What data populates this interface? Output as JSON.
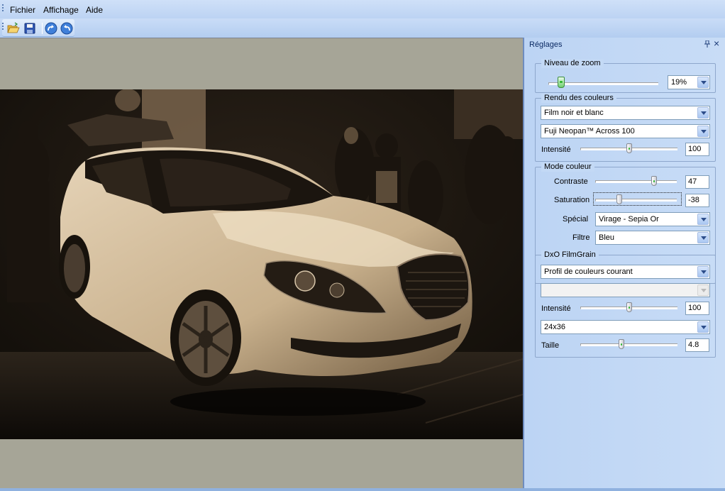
{
  "menu": {
    "items": [
      {
        "label": "Fichier"
      },
      {
        "label": "Affichage"
      },
      {
        "label": "Aide"
      }
    ]
  },
  "toolbar": {
    "icons": [
      "open-folder-icon",
      "save-icon",
      "redo-icon",
      "undo-icon"
    ]
  },
  "panel": {
    "title": "Réglages",
    "zoom": {
      "legend": "Niveau de zoom",
      "value": "19%",
      "slider_fraction": 0.12
    },
    "color_rendering": {
      "legend": "Rendu des couleurs",
      "category": "Film noir et blanc",
      "film": "Fuji Neopan™ Across 100",
      "intensity_label": "Intensité",
      "intensity_value": "100"
    },
    "color_mode": {
      "legend": "Mode couleur",
      "contrast_label": "Contraste",
      "contrast_value": "47",
      "saturation_label": "Saturation",
      "saturation_value": "-38",
      "special_label": "Spécial",
      "special_value": "Virage - Sepia Or",
      "filter_label": "Filtre",
      "filter_value": "Bleu"
    },
    "filmgrain": {
      "legend": "DxO FilmGrain",
      "profile": "Profil de couleurs courant",
      "disabled_value": "",
      "intensity_label": "Intensité",
      "intensity_value": "100",
      "format": "24x36",
      "size_label": "Taille",
      "size_value": "4.8"
    }
  },
  "colors": {
    "accent": "#316ac5",
    "panel_bg": "#c3d9f5",
    "viewport_bg": "#a6a597",
    "photo_tone": "#d9c4a6"
  }
}
